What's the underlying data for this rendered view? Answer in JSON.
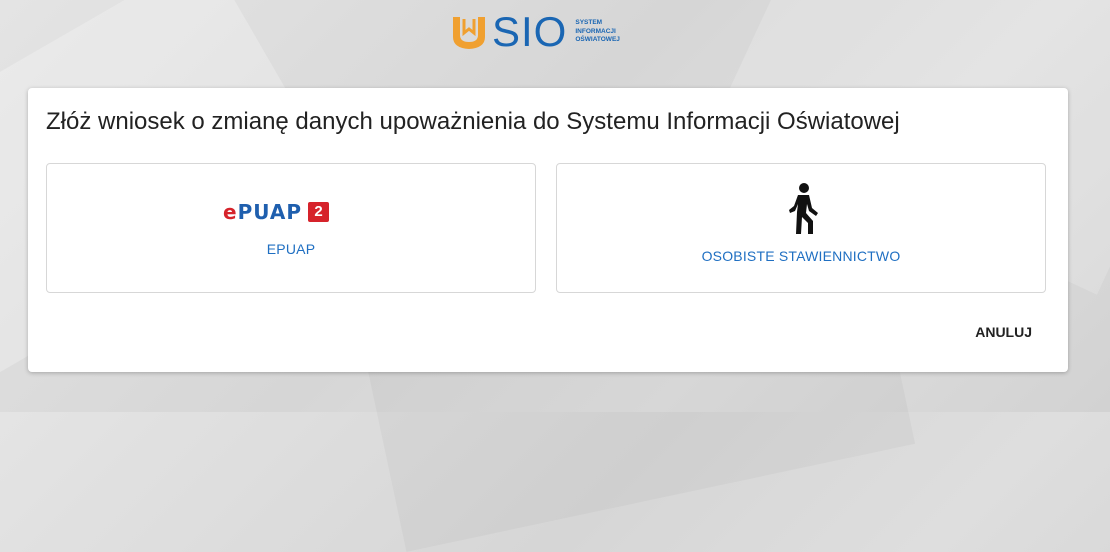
{
  "header": {
    "logo_text": "SIO",
    "logo_sub": [
      "SYSTEM",
      "INFORMACJI",
      "OŚWIATOWEJ"
    ],
    "logo_colors": {
      "text": "#1a66b3",
      "mark": "#f0a030"
    }
  },
  "dialog": {
    "title": "Złóż wniosek o zmianę danych upoważnienia do Systemu Informacji Oświatowej",
    "options": [
      {
        "id": "epuap",
        "label": "EPUAP",
        "icon": "epuap-logo-icon",
        "logo_word": "ePUAP",
        "logo_badge": "2"
      },
      {
        "id": "personal",
        "label": "OSOBISTE STAWIENNICTWO",
        "icon": "walking-person-icon"
      }
    ],
    "cancel_label": "ANULUJ",
    "accent_color": "#1f6fc2"
  }
}
